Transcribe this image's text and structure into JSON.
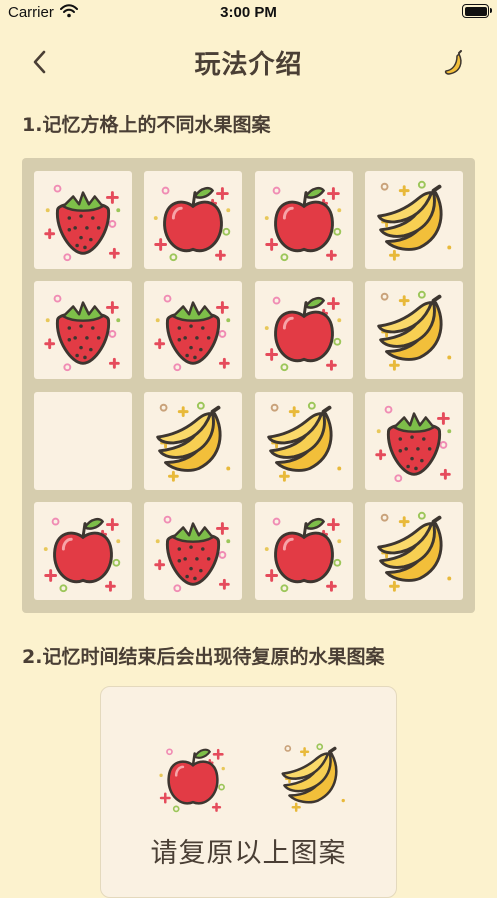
{
  "status_bar": {
    "carrier": "Carrier",
    "time": "3:00 PM"
  },
  "nav": {
    "title": "玩法介绍",
    "back_icon": "chevron-left-icon",
    "right_icon": "banana-icon"
  },
  "steps": [
    {
      "text": "1.记忆方格上的不同水果图案"
    },
    {
      "text": "2.记忆时间结束后会出现待复原的水果图案"
    }
  ],
  "board": {
    "rows": [
      [
        "strawberry",
        "apple",
        "apple",
        "banana"
      ],
      [
        "strawberry",
        "strawberry",
        "apple",
        "banana"
      ],
      [
        "empty",
        "banana",
        "banana",
        "strawberry"
      ],
      [
        "apple",
        "strawberry",
        "apple",
        "banana"
      ]
    ]
  },
  "example": {
    "fruits": [
      "apple",
      "banana"
    ],
    "caption": "请复原以上图案"
  },
  "colors": {
    "background": "#FCF2CE",
    "board": "#D6CDAE",
    "tile": "#FAF1E2",
    "text": "#4a3f35"
  }
}
